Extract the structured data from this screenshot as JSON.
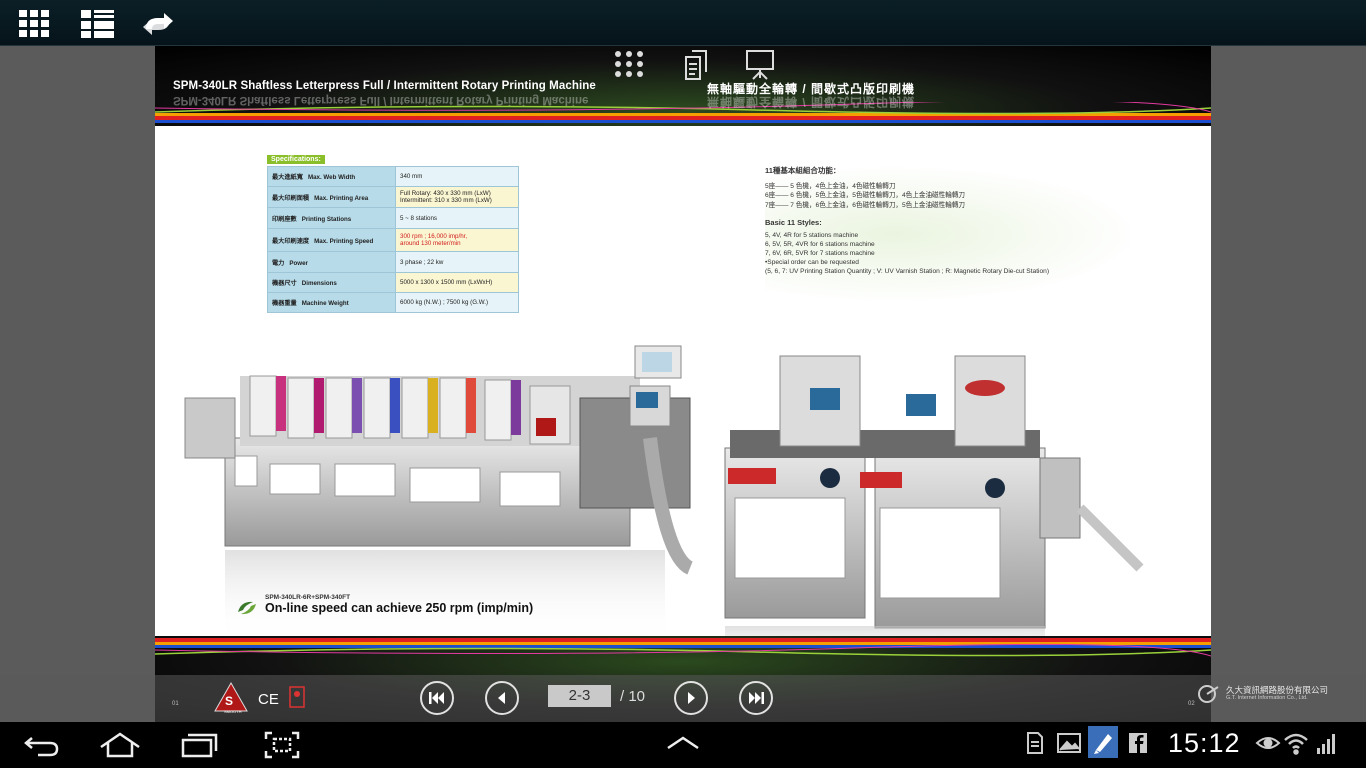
{
  "top_bar": {
    "buttons": [
      {
        "name": "thumbnail-grid-icon"
      },
      {
        "name": "list-view-icon"
      },
      {
        "name": "share-icon"
      }
    ]
  },
  "overlay_toolbar": {
    "buttons": [
      {
        "name": "grid-dots-icon"
      },
      {
        "name": "copy-pages-icon"
      },
      {
        "name": "presentation-icon"
      }
    ]
  },
  "page": {
    "header": {
      "title_en": "SPM-340LR Shaftless Letterpress Full / Intermittent Rotary Printing Machine",
      "title_zh": "無軸驅動全輪轉 / 間歇式凸版印刷機"
    },
    "specifications": {
      "tag": "Specifications:",
      "rows": [
        {
          "zh": "最大進紙寬",
          "en": "Max. Web Width",
          "value": "340 mm",
          "red": false
        },
        {
          "zh": "最大印刷面積",
          "en": "Max. Printing Area",
          "value": "Full Rotary: 430 x 330 mm (LxW)\nIntermittent: 310 x 330 mm (LxW)",
          "red": false
        },
        {
          "zh": "印刷座數",
          "en": "Printing Stations",
          "value": "5 ~ 8 stations",
          "red": false
        },
        {
          "zh": "最大印刷速度",
          "en": "Max. Printing Speed",
          "value": "300 rpm ; 16,000 imp/hr,\naround 130 meter/min",
          "red": true
        },
        {
          "zh": "電力",
          "en": "Power",
          "value": "3 phase ; 22 kw",
          "red": false
        },
        {
          "zh": "機器尺寸",
          "en": "Dimensions",
          "value": "5000 x 1300 x 1500 mm (LxWxH)",
          "red": false
        },
        {
          "zh": "機器重量",
          "en": "Machine Weight",
          "value": "6000 kg (N.W.) ; 7500 kg (G.W.)",
          "red": false
        }
      ]
    },
    "styles": {
      "title_zh": "11種基本組組合功能：",
      "zh_lines": [
        "5座—— 5 色機，4色上金油，4色磁性輪轉刀",
        "6座—— 6 色機，5色上金油，5色磁性輪轉刀，4色上金油磁性輪轉刀",
        "7座—— 7 色機，6色上金油，6色磁性輪轉刀，5色上金油磁性輪轉刀"
      ],
      "title_en": "Basic 11 Styles:",
      "en_lines": [
        "5, 4V, 4R for 5 stations machine",
        "6, 5V, 5R, 4VR for 6 stations machine",
        "7, 6V, 6R, 5VR for 7 stations machine",
        "•Special order can be requested",
        "(5, 6, 7: UV Printing Station Quantity ; V: UV Varnish Station ; R: Magnetic Rotary Die-cut Station)"
      ]
    },
    "caption": {
      "model": "SPM-340LR-6R+SPM-340FT",
      "text": "On-line speed can achieve 250 rpm (imp/min)"
    },
    "footer": {
      "page_left": "01",
      "page_right": "02",
      "logo_left": "SMOOTH",
      "ce_mark": "CE",
      "company_zh": "久大資訊網路股份有限公司",
      "company_en": "G.T. Internet Information Co., Ltd."
    }
  },
  "pager": {
    "current": "2-3",
    "total": "/ 10",
    "buttons": [
      {
        "name": "first-page-icon"
      },
      {
        "name": "prev-page-icon"
      },
      {
        "name": "next-page-icon"
      },
      {
        "name": "last-page-icon"
      }
    ]
  },
  "system_bar": {
    "clock": "15:12",
    "nav": [
      "back-icon",
      "home-icon",
      "recent-apps-icon",
      "screenshot-icon"
    ],
    "status": [
      "sd-card-icon",
      "gallery-icon",
      "edit-icon",
      "facebook-icon",
      "eye-icon",
      "wifi-icon",
      "signal-icon"
    ]
  },
  "colors": {
    "spec_key_bg": "#b7dbe9",
    "spec_value_bg": "#e6f3f8",
    "spec_alt_bg": "#fbf6d2",
    "spec_tag_bg": "#8bbf2a",
    "speed_red": "#d01c1c"
  }
}
